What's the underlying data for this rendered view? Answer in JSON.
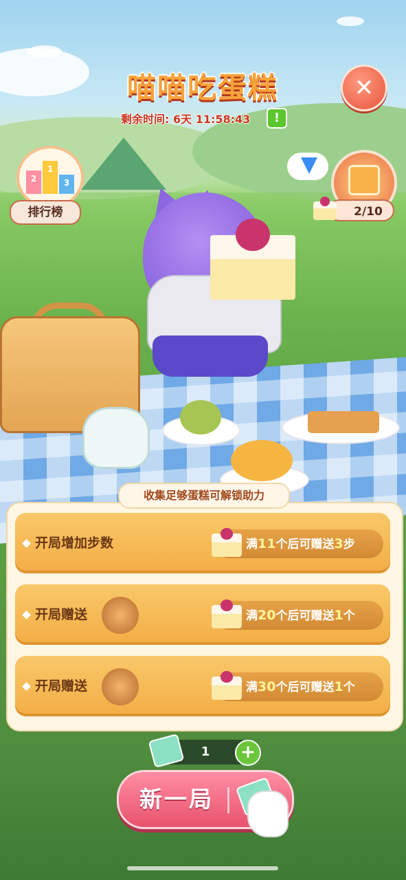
{
  "header": {
    "title": "喵喵吃蛋糕",
    "timer_label": "剩余时间:",
    "timer_days": "6天",
    "timer_time": "11:58:43",
    "alert_icon": "!",
    "close_icon": "✕"
  },
  "ranking": {
    "label": "排行榜",
    "podium": [
      "2",
      "1",
      "3"
    ]
  },
  "reward_progress": {
    "count": "2/10"
  },
  "panel": {
    "header": "收集足够蛋糕可解锁助力",
    "rows": [
      {
        "label": "开局增加步数",
        "icon": "",
        "reward_prefix": "满",
        "reward_num": "11",
        "reward_mid": "个后可赠送",
        "reward_amount": "3",
        "reward_unit": "步"
      },
      {
        "label": "开局赠送",
        "icon": "cannon-icon",
        "reward_prefix": "满",
        "reward_num": "20",
        "reward_mid": "个后可赠送",
        "reward_amount": "1",
        "reward_unit": "个"
      },
      {
        "label": "开局赠送",
        "icon": "hammer-icon",
        "reward_prefix": "满",
        "reward_num": "30",
        "reward_mid": "个后可赠送",
        "reward_amount": "1",
        "reward_unit": "个"
      }
    ]
  },
  "ticket": {
    "count": "1",
    "plus": "+"
  },
  "start": {
    "label": "新一局"
  }
}
